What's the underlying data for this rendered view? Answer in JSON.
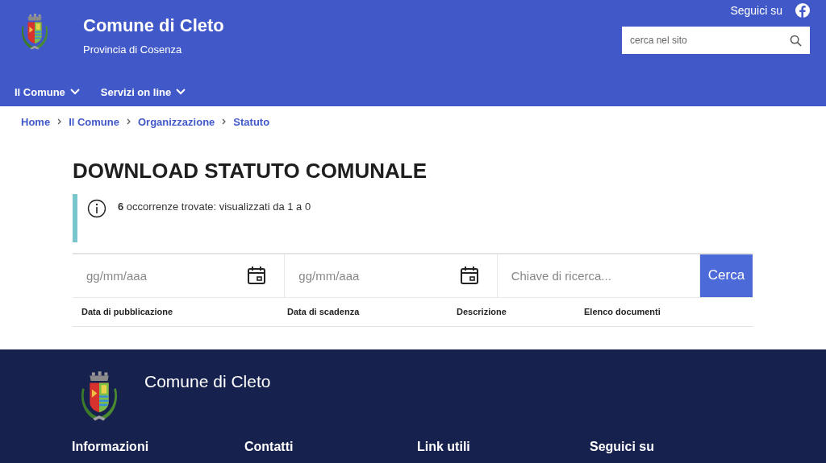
{
  "header": {
    "title": "Comune di Cleto",
    "subtitle": "Provincia di Cosenza",
    "social_label": "Seguici su",
    "search": {
      "placeholder": "cerca nel sito"
    }
  },
  "nav": [
    {
      "label": "Il Comune"
    },
    {
      "label": "Servizi on line"
    }
  ],
  "breadcrumb": [
    "Home",
    "Il Comune",
    "Organizzazione",
    "Statuto"
  ],
  "page_title": "DOWNLOAD STATUTO COMUNALE",
  "info": "**6** occorrenze trovate: visualizzati da 1 a 0",
  "filters": {
    "date_from": {
      "placeholder": "gg/mm/aaa"
    },
    "date_to": {
      "placeholder": "gg/mm/aaa"
    },
    "keyword": {
      "placeholder": "Chiave di ricerca..."
    },
    "button": "Cerca"
  },
  "table": {
    "columns": [
      "Data di pubblicazione",
      "Data di scadenza",
      "Descrizione",
      "Elenco documenti"
    ]
  },
  "footer": {
    "title": "Comune di Cleto",
    "sections": [
      "Informazioni",
      "Contatti",
      "Link utili",
      "Seguici su"
    ]
  }
}
